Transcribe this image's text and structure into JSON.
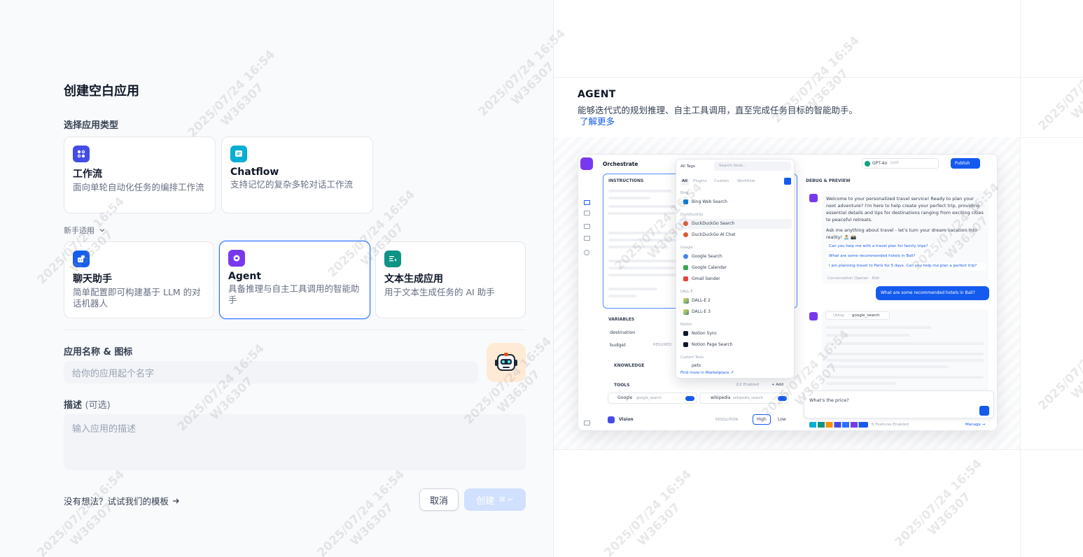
{
  "form": {
    "title": "创建空白应用",
    "type_label": "选择应用类型",
    "types_top": [
      {
        "name": "工作流",
        "desc": "面向单轮自动化任务的编排工作流",
        "color": "#444ce7"
      },
      {
        "name": "Chatflow",
        "desc": "支持记忆的复杂多轮对话工作流",
        "color": "#06aed4"
      }
    ],
    "beginner_label": "新手适用",
    "types_beginner": [
      {
        "name": "聊天助手",
        "desc": "简单配置即可构建基于 LLM 的对话机器人",
        "color": "#155eef"
      },
      {
        "name": "Agent",
        "desc": "具备推理与自主工具调用的智能助手",
        "color": "#7839ee"
      },
      {
        "name": "文本生成应用",
        "desc": "用于文本生成任务的 AI 助手",
        "color": "#0e9384"
      }
    ],
    "name_label": "应用名称 & 图标",
    "name_placeholder": "给你的应用起个名字",
    "desc_label": "描述",
    "desc_optional": "(可选)",
    "desc_placeholder": "输入应用的描述",
    "template_link": "没有想法？试试我们的模板",
    "cancel": "取消",
    "create": "创建",
    "create_kbd": "⌘ ↵"
  },
  "preview": {
    "type_title": "AGENT",
    "type_desc": "能够迭代式的规划推理、自主工具调用，直至完成任务目标的智能助手。",
    "learn_more": "了解更多",
    "screenshot": {
      "orchestrate": "Orchestrate",
      "instructions": "INSTRUCTIONS",
      "variables": "VARIABLES",
      "var1": "destination",
      "var2": "budget",
      "required": "REQUIRED",
      "knowledge": "KNOWLEDGE",
      "tools": "TOOLS",
      "tools_enabled": "2/2 Enabled",
      "add": "+ Add",
      "tool1": "Google",
      "tool1_id": "google_search",
      "tool2": "wikipedia",
      "tool2_id": "wikipedia_search",
      "vision": "Vision",
      "resolution": "RESOLUTION",
      "high": "High",
      "low": "Low",
      "all_tags": "All Tags",
      "search_tools": "Search tools...",
      "tabs": [
        "All",
        "Plugins",
        "Custom",
        "Workflow"
      ],
      "groups": [
        {
          "name": "Bing",
          "items": [
            "Bing Web Search"
          ]
        },
        {
          "name": "DuckDuckGo",
          "items": [
            "DuckDuckGo Search",
            "DuckDuckGo AI Chat"
          ]
        },
        {
          "name": "Google",
          "items": [
            "Google Search",
            "Google Calendar",
            "Gmail Sender"
          ]
        },
        {
          "name": "DALL-E",
          "items": [
            "DALL-E 2",
            "DALL-E 3"
          ]
        },
        {
          "name": "Notion",
          "items": [
            "Notion Sync",
            "Notion Page Search"
          ]
        },
        {
          "name": "Custom Tools",
          "items": [
            "pets"
          ]
        }
      ],
      "find_more": "Find more in Marketplace ↗",
      "model": "GPT-4o",
      "model_tag": "CHAT",
      "publish": "Publish",
      "debug": "DEBUG & PREVIEW",
      "welcome": "Welcome to your personalized travel service! Ready to plan your next adventure? I'm here to help create your perfect trip, providing essential details and tips for destinations ranging from exciting cities to peaceful retreats.",
      "ask": "Ask me anything about travel - let's turn your dream vacation into reality! 🏝️ 📸",
      "suggestions": [
        "Can you help me with a travel plan for family trips?",
        "What are some recommended hotels in Bali?",
        "I am planning travel to Paris for 5 days. Can you help me plan a perfect trip?"
      ],
      "opener": "Conversation Opener · Edit",
      "user_msg": "What are some recommended hotels in Bali?",
      "using": "Using",
      "using_tool": "google_search",
      "input_value": "What's the price?",
      "features": "6 Features Enabled",
      "manage": "Manage →"
    }
  },
  "watermark": {
    "line1": "2025/07/24 16:54",
    "line2": "W36307"
  }
}
